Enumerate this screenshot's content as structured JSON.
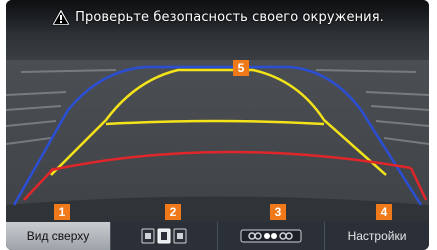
{
  "warning": {
    "text": "Проверьте безопасность своего окружения.",
    "icon": "warning-triangle-icon"
  },
  "markers": [
    "1",
    "2",
    "3",
    "4",
    "5"
  ],
  "guidelines": {
    "colors": {
      "red": "#e0262a",
      "yellow": "#f5e31a",
      "blue": "#2b4fd4"
    }
  },
  "bottom_bar": {
    "top_view_label": "Вид сверху",
    "camera_view_icon": "camera-view-toggle-icon",
    "parking_sensor_icon": "parking-sensor-icon",
    "settings_label": "Настройки"
  },
  "colors": {
    "marker": "#f07a1a",
    "bar": "#2b3038"
  }
}
